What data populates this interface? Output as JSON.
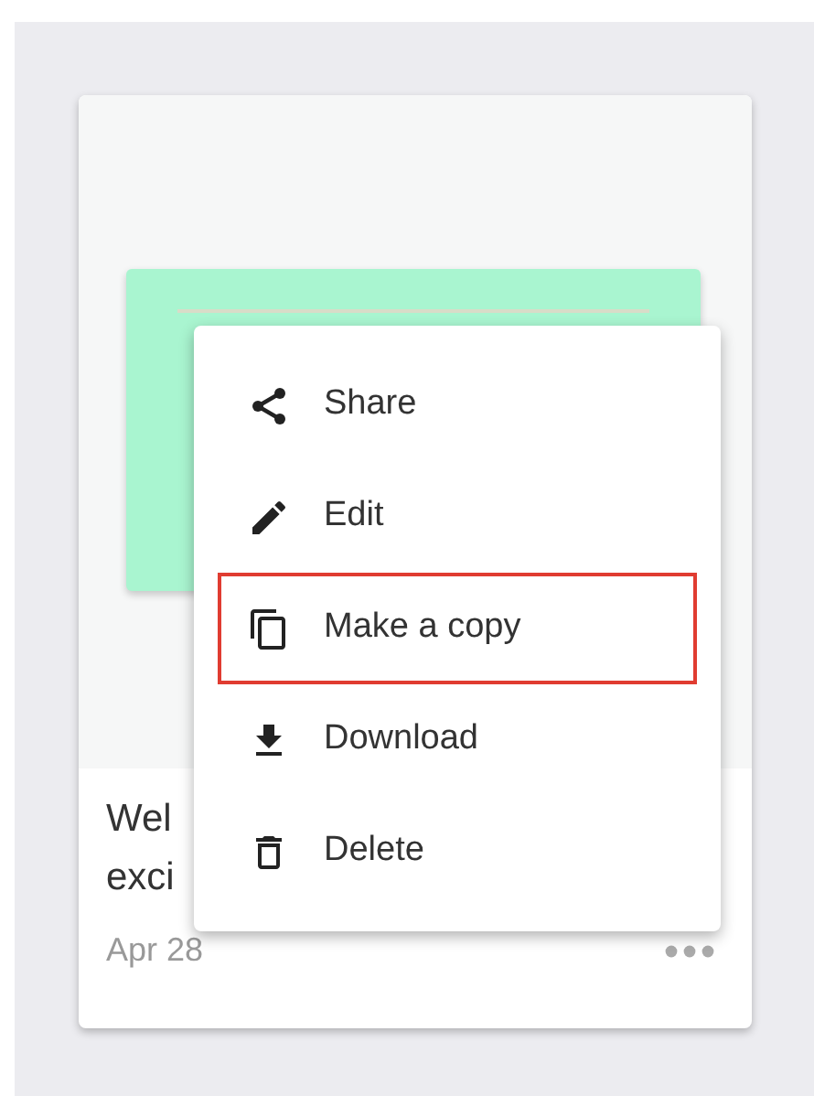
{
  "card": {
    "title_lines": [
      "Wel",
      "exci"
    ],
    "date": "Apr 28"
  },
  "menu": {
    "items": [
      {
        "label": "Share",
        "selected": false
      },
      {
        "label": "Edit",
        "selected": false
      },
      {
        "label": "Make a copy",
        "selected": true
      },
      {
        "label": "Download",
        "selected": false
      },
      {
        "label": "Delete",
        "selected": false
      }
    ]
  }
}
